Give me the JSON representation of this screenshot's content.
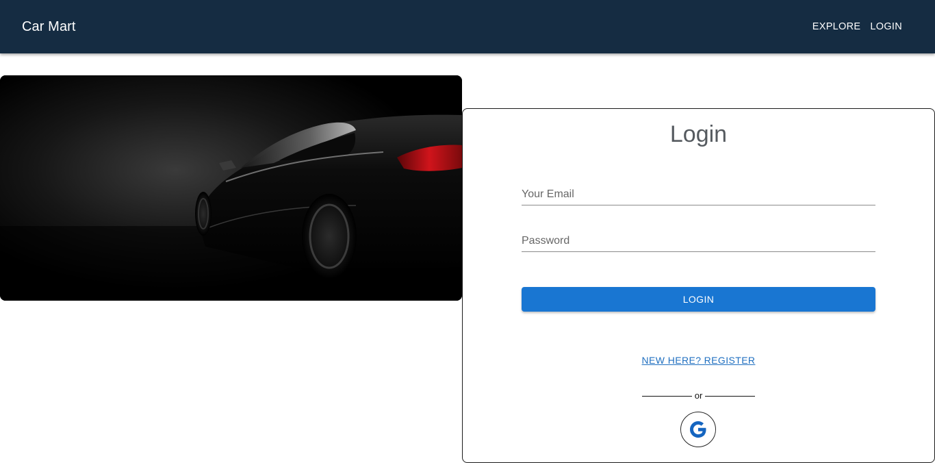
{
  "appbar": {
    "brand": "Car Mart",
    "nav": [
      {
        "label": "EXPLORE"
      },
      {
        "label": "LOGIN"
      }
    ],
    "background_color": "#152c42"
  },
  "login_card": {
    "title": "Login",
    "email": {
      "placeholder": "Your Email",
      "value": ""
    },
    "password": {
      "placeholder": "Password",
      "value": ""
    },
    "login_button": "LOGIN",
    "register_link": "NEW HERE? REGISTER",
    "divider_text": "or",
    "google_icon": "google-icon",
    "accent_color": "#1976d2"
  },
  "hero": {
    "icon": "car-photo"
  }
}
